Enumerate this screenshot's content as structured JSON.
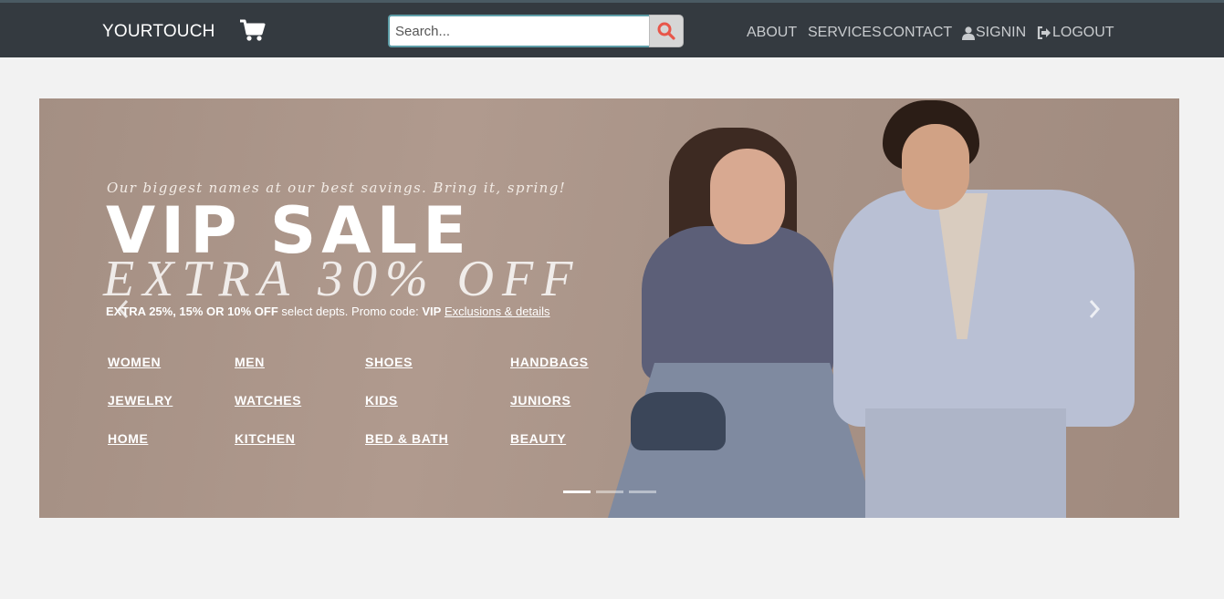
{
  "navbar": {
    "brand": "YOURTOUCH",
    "cart_icon": "shopping-cart-icon",
    "search": {
      "placeholder": "Search...",
      "value": "",
      "button_icon": "search-icon"
    },
    "links": [
      {
        "label": "ABOUT",
        "icon": ""
      },
      {
        "label": "SERVICES",
        "icon": ""
      },
      {
        "label": "CONTACT",
        "icon": ""
      },
      {
        "label": "SIGNIN",
        "icon": "user-icon"
      },
      {
        "label": "LOGOUT",
        "icon": "sign-out-icon"
      }
    ],
    "colors": {
      "background": "#343a40",
      "link": "#c8cbce",
      "search_icon": "#e8564a"
    }
  },
  "carousel": {
    "tagline": "Our biggest names at our best savings. Bring it, spring!",
    "headline": "VIP SALE",
    "subheadline": "EXTRA 30% OFF",
    "promo": {
      "bold": "EXTRA 25%, 15% OR 10% OFF",
      "text": " select depts. Promo code: ",
      "code": "VIP",
      "link": "Exclusions & details"
    },
    "categories": [
      [
        "WOMEN",
        "MEN",
        "SHOES",
        "HANDBAGS"
      ],
      [
        "JEWELRY",
        "WATCHES",
        "KIDS",
        "JUNIORS"
      ],
      [
        "HOME",
        "KITCHEN",
        "BED & BATH",
        "BEAUTY"
      ]
    ],
    "prev_icon": "chevron-left-icon",
    "next_icon": "chevron-right-icon",
    "slide_count": 3,
    "active_slide": 1
  }
}
